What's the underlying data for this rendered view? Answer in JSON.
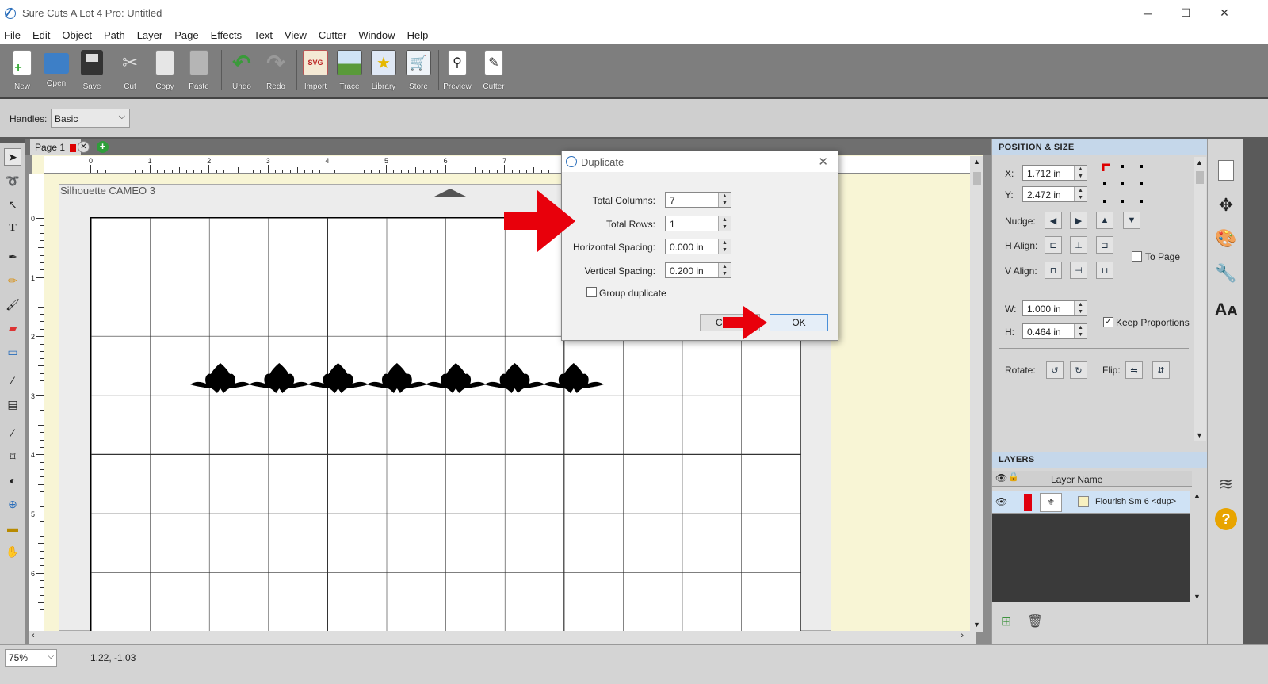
{
  "window": {
    "title": "Sure Cuts A Lot 4 Pro: Untitled",
    "minimize": "─",
    "maximize": "☐",
    "close": "✕"
  },
  "menu": [
    "File",
    "Edit",
    "Object",
    "Path",
    "Layer",
    "Page",
    "Effects",
    "Text",
    "View",
    "Cutter",
    "Window",
    "Help"
  ],
  "toolbar": [
    {
      "label": "New",
      "icon": "new-document-icon"
    },
    {
      "label": "Open",
      "icon": "open-folder-icon"
    },
    {
      "label": "Save",
      "icon": "save-disk-icon"
    },
    {
      "label": "Cut",
      "icon": "scissors-icon"
    },
    {
      "label": "Copy",
      "icon": "copy-icon"
    },
    {
      "label": "Paste",
      "icon": "paste-icon"
    },
    {
      "label": "Undo",
      "icon": "undo-icon"
    },
    {
      "label": "Redo",
      "icon": "redo-icon"
    },
    {
      "label": "Import",
      "icon": "import-svg-icon"
    },
    {
      "label": "Trace",
      "icon": "trace-icon"
    },
    {
      "label": "Library",
      "icon": "library-star-icon"
    },
    {
      "label": "Store",
      "icon": "store-cart-icon"
    },
    {
      "label": "Preview",
      "icon": "preview-magnifier-icon"
    },
    {
      "label": "Cutter",
      "icon": "cutter-blade-icon"
    }
  ],
  "handles": {
    "label": "Handles:",
    "value": "Basic"
  },
  "page_tab": {
    "label": "Page 1"
  },
  "canvas": {
    "cutter_name": "Silhouette CAMEO 3",
    "ruler_top": [
      "0",
      "1",
      "2",
      "3",
      "4",
      "5",
      "6",
      "7"
    ],
    "ruler_left": [
      "0",
      "1",
      "2",
      "3",
      "4",
      "5",
      "6"
    ],
    "flourish_count": 7
  },
  "dialog": {
    "title": "Duplicate",
    "total_columns_label": "Total Columns:",
    "total_columns": "7",
    "total_rows_label": "Total Rows:",
    "total_rows": "1",
    "h_spacing_label": "Horizontal Spacing:",
    "h_spacing": "0.000 in",
    "v_spacing_label": "Vertical Spacing:",
    "v_spacing": "0.200 in",
    "group_label": "Group duplicate",
    "cancel_visible": "Ca",
    "ok": "OK"
  },
  "position_size": {
    "title": "POSITION & SIZE",
    "x_label": "X:",
    "x": "1.712 in",
    "y_label": "Y:",
    "y": "2.472 in",
    "nudge_label": "Nudge:",
    "halign_label": "H Align:",
    "valign_label": "V Align:",
    "to_page_label": "To Page",
    "w_label": "W:",
    "w": "1.000 in",
    "h_label": "H:",
    "h": "0.464 in",
    "keep_proportions_label": "Keep Proportions",
    "rotate_label": "Rotate:",
    "flip_label": "Flip:"
  },
  "layers": {
    "title": "LAYERS",
    "col_header": "Layer Name",
    "items": [
      {
        "name": "Flourish Sm 6 <dup>",
        "color": "#e0000f"
      }
    ]
  },
  "status": {
    "zoom": "75%",
    "coords": "1.22, -1.03"
  },
  "colors": {
    "accent_red": "#e8000b",
    "toolbar_bg": "#7e7e7e",
    "panel_title": "#c5d7ea"
  }
}
